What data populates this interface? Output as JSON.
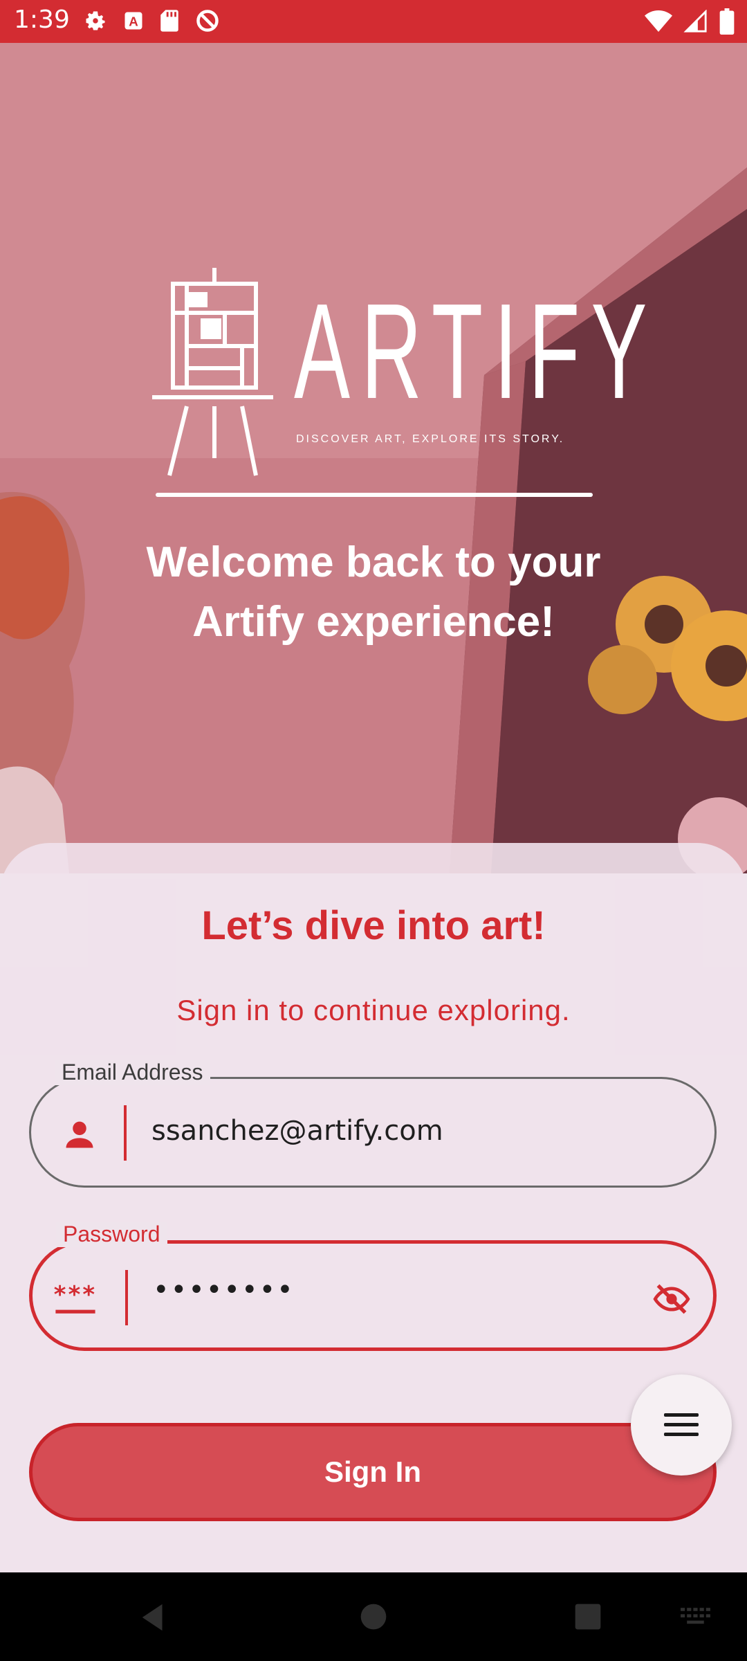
{
  "status_bar": {
    "time": "1:39",
    "icons": [
      "settings-icon",
      "a-icon",
      "sd-card-icon",
      "no-entry-icon",
      "wifi-icon",
      "signal-icon",
      "battery-icon"
    ]
  },
  "hero": {
    "logo_text": "ARTIFY",
    "tagline": "DISCOVER ART, EXPLORE ITS STORY.",
    "welcome_line1": "Welcome back to your",
    "welcome_line2": "Artify experience!"
  },
  "card": {
    "title": "Let’s dive into art!",
    "subtitle": "Sign in to continue exploring.",
    "email": {
      "label": "Email Address",
      "value": "ssanchez@artify.com",
      "icon": "person-icon"
    },
    "password": {
      "label": "Password",
      "value": "••••••••",
      "icon": "password-asterisk-icon",
      "toggle_icon": "visibility-off-icon"
    },
    "signin_label": "Sign In"
  },
  "fab": {
    "icon": "menu-icon"
  },
  "nav_bar": {
    "icons": [
      "back-icon",
      "home-icon",
      "recents-icon",
      "keyboard-icon"
    ]
  },
  "colors": {
    "accent": "#d32c32",
    "card_bg": "#efe4ec",
    "button_fill": "#d64c54"
  }
}
